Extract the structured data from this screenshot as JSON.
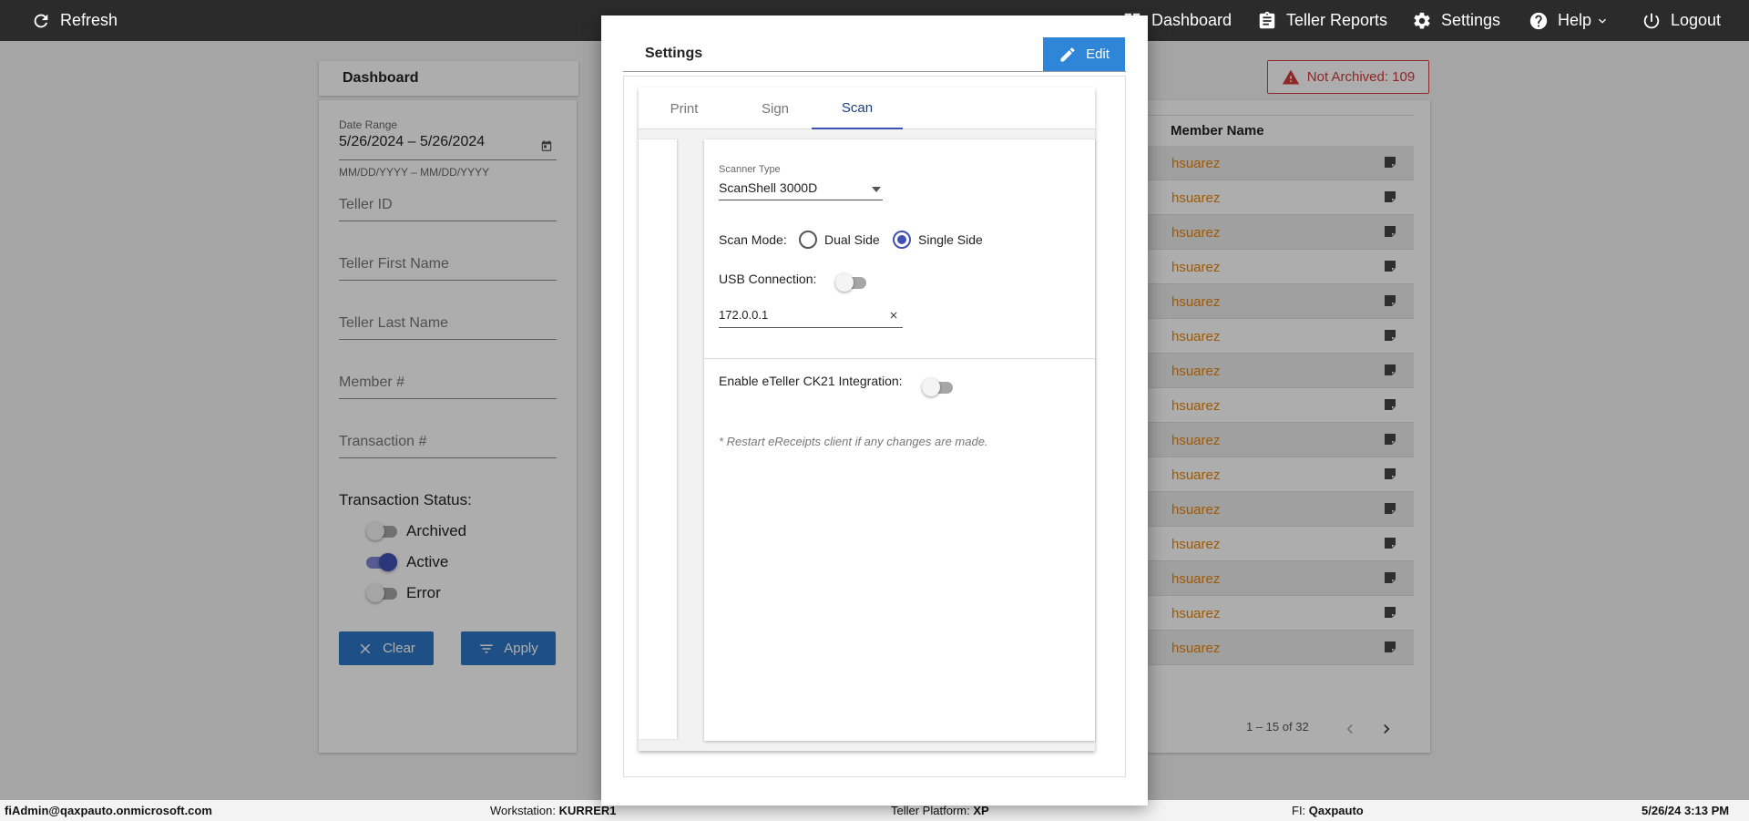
{
  "topbar": {
    "refresh": "Refresh",
    "dashboard": "Dashboard",
    "teller_reports": "Teller Reports",
    "settings": "Settings",
    "help": "Help",
    "logout": "Logout"
  },
  "dashboard": {
    "title": "Dashboard",
    "date_range_label": "Date Range",
    "date_range_value": "5/26/2024 – 5/26/2024",
    "date_hint": "MM/DD/YYYY – MM/DD/YYYY",
    "fields": [
      "Teller ID",
      "Teller First Name",
      "Teller Last Name",
      "Member #",
      "Transaction #"
    ],
    "status_label": "Transaction Status:",
    "toggles": [
      {
        "label": "Archived",
        "on": false
      },
      {
        "label": "Active",
        "on": true
      },
      {
        "label": "Error",
        "on": false
      }
    ],
    "clear_label": "Clear",
    "apply_label": "Apply"
  },
  "table": {
    "not_archived": "Not Archived: 109",
    "member_name_header": "Member Name",
    "rows": [
      "hsuarez",
      "hsuarez",
      "hsuarez",
      "hsuarez",
      "hsuarez",
      "hsuarez",
      "hsuarez",
      "hsuarez",
      "hsuarez",
      "hsuarez",
      "hsuarez",
      "hsuarez",
      "hsuarez",
      "hsuarez",
      "hsuarez"
    ],
    "pager_text": "1 – 15 of 32"
  },
  "modal": {
    "title": "Settings",
    "edit_label": "Edit",
    "tabs": [
      "Print",
      "Sign",
      "Scan"
    ],
    "active_tab": "Scan",
    "scanner_type_label": "Scanner Type",
    "scanner_type_value": "ScanShell 3000D",
    "scan_mode_label": "Scan Mode:",
    "scan_mode_options": [
      "Dual Side",
      "Single Side"
    ],
    "scan_mode_selected": "Single Side",
    "usb_label": "USB Connection:",
    "usb_on": false,
    "ip_value": "172.0.0.1",
    "eteller_label": "Enable eTeller CK21 Integration:",
    "eteller_on": false,
    "note": "* Restart eReceipts client if any changes are made."
  },
  "statusbar": {
    "user": "fiAdmin@qaxpauto.onmicrosoft.com",
    "workstation_label": "Workstation:",
    "workstation_value": "KURRER1",
    "platform_label": "Teller Platform:",
    "platform_value": "XP",
    "fi_label": "FI:",
    "fi_value": "Qaxpauto",
    "datetime": "5/26/24 3:13 PM"
  },
  "colors": {
    "topbar": "#2b2b2b",
    "primary_button": "#2f76c5",
    "accent": "#3f51b5",
    "member_link": "#e8840c",
    "alert": "#d23a3a"
  }
}
